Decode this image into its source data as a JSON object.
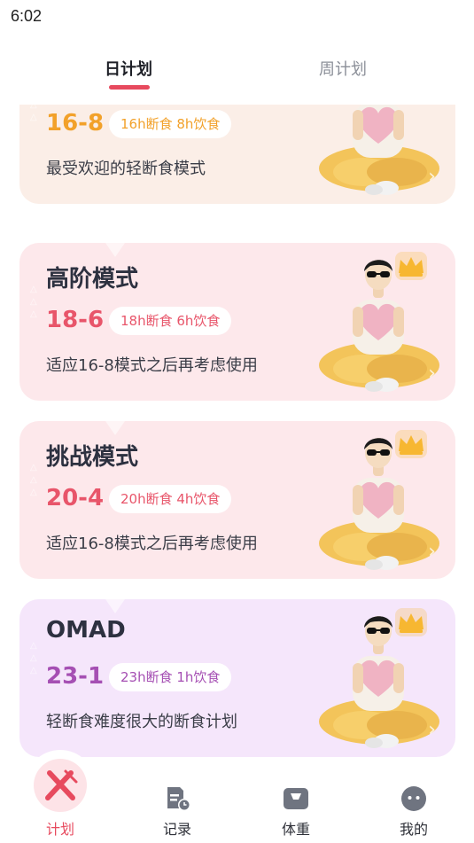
{
  "status_bar": {
    "time": "6:02"
  },
  "tabs": [
    {
      "label": "日计划",
      "active": true
    },
    {
      "label": "周计划",
      "active": false
    }
  ],
  "cards": [
    {
      "title": "",
      "ratio": "16-8",
      "pill": "16h断食 8h饮食",
      "desc": "最受欢迎的轻断食模式",
      "bg": "#fbeee7",
      "ratio_color": "#f2a12a",
      "pill_color": "#f2a12a",
      "crown": false
    },
    {
      "title": "高阶模式",
      "ratio": "18-6",
      "pill": "18h断食 6h饮食",
      "desc": "适应16-8模式之后再考虑使用",
      "bg": "#fde8eb",
      "ratio_color": "#e8556a",
      "pill_color": "#e8556a",
      "crown": true
    },
    {
      "title": "挑战模式",
      "ratio": "20-4",
      "pill": "20h断食 4h饮食",
      "desc": "适应16-8模式之后再考虑使用",
      "bg": "#fde8eb",
      "ratio_color": "#e8556a",
      "pill_color": "#e8556a",
      "crown": true
    },
    {
      "title": "OMAD",
      "ratio": "23-1",
      "pill": "23h断食 1h饮食",
      "desc": "轻断食难度很大的断食计划",
      "bg": "#f5e6fb",
      "ratio_color": "#a54fb3",
      "pill_color": "#a54fb3",
      "crown": true
    }
  ],
  "bottom_nav": [
    {
      "label": "计划",
      "icon": "fork-knife-icon",
      "active": true
    },
    {
      "label": "记录",
      "icon": "record-icon",
      "active": false
    },
    {
      "label": "体重",
      "icon": "scale-icon",
      "active": false
    },
    {
      "label": "我的",
      "icon": "profile-icon",
      "active": false
    }
  ],
  "colors": {
    "accent": "#e74a5e",
    "crown": "#f7b731"
  }
}
